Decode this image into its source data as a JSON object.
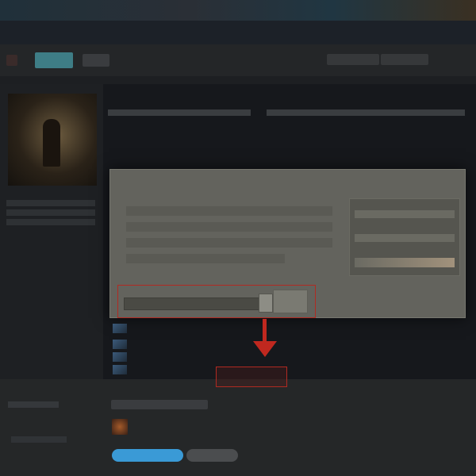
{
  "window": {
    "title": ""
  },
  "dialog": {
    "title": ""
  },
  "colors": {
    "accent": "#3a9ad6",
    "highlight": "#c0281f",
    "dialog_bg": "#63635d"
  },
  "icons": [
    "arrow-down-icon",
    "game-cover-image"
  ],
  "buttons": {
    "primary": "",
    "secondary": ""
  }
}
